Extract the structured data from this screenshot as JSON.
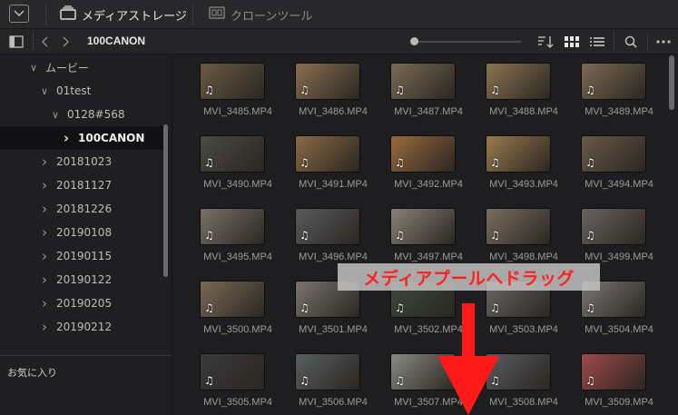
{
  "topbar": {
    "tab_media": "メディアストレージ",
    "tab_clone": "クローンツール"
  },
  "toolbar": {
    "path": "100CANON"
  },
  "sidebar": {
    "items": [
      {
        "label": "ムービー",
        "level": 2,
        "expanded": true
      },
      {
        "label": "01test",
        "level": 3,
        "expanded": true
      },
      {
        "label": "0128#568",
        "level": 4,
        "expanded": true
      },
      {
        "label": "100CANON",
        "level": 5,
        "expanded": false,
        "selected": true
      },
      {
        "label": "20181023",
        "level": 3
      },
      {
        "label": "20181127",
        "level": 3
      },
      {
        "label": "20181226",
        "level": 3
      },
      {
        "label": "20190108",
        "level": 3
      },
      {
        "label": "20190115",
        "level": 3
      },
      {
        "label": "20190122",
        "level": 3
      },
      {
        "label": "20190205",
        "level": 3
      },
      {
        "label": "20190212",
        "level": 3
      }
    ],
    "favorites_label": "お気に入り"
  },
  "clips": [
    {
      "name": "MVI_3485.MP4",
      "color": "#6b5a44"
    },
    {
      "name": "MVI_3486.MP4",
      "color": "#8a6f4f"
    },
    {
      "name": "MVI_3487.MP4",
      "color": "#7a6a55"
    },
    {
      "name": "MVI_3488.MP4",
      "color": "#8c7452"
    },
    {
      "name": "MVI_3489.MP4",
      "color": "#7d6a52"
    },
    {
      "name": "MVI_3490.MP4",
      "color": "#4a4a44"
    },
    {
      "name": "MVI_3491.MP4",
      "color": "#8a6a44"
    },
    {
      "name": "MVI_3492.MP4",
      "color": "#9a6a3c"
    },
    {
      "name": "MVI_3493.MP4",
      "color": "#9a7a4e"
    },
    {
      "name": "MVI_3494.MP4",
      "color": "#6a5a48"
    },
    {
      "name": "MVI_3495.MP4",
      "color": "#7a7268"
    },
    {
      "name": "MVI_3496.MP4",
      "color": "#5a5a5e"
    },
    {
      "name": "MVI_3497.MP4",
      "color": "#8a8278"
    },
    {
      "name": "MVI_3498.MP4",
      "color": "#7a6e60"
    },
    {
      "name": "MVI_3499.MP4",
      "color": "#6a6460"
    },
    {
      "name": "MVI_3500.MP4",
      "color": "#7a6a58"
    },
    {
      "name": "MVI_3501.MP4",
      "color": "#7a746c"
    },
    {
      "name": "MVI_3502.MP4",
      "color": "#3c4a3a"
    },
    {
      "name": "MVI_3503.MP4",
      "color": "#6a6664"
    },
    {
      "name": "MVI_3504.MP4",
      "color": "#7a7874"
    },
    {
      "name": "MVI_3505.MP4",
      "color": "#3a3a3c"
    },
    {
      "name": "MVI_3506.MP4",
      "color": "#5a5e60"
    },
    {
      "name": "MVI_3507.MP4",
      "color": "#8a8a84"
    },
    {
      "name": "MVI_3508.MP4",
      "color": "#5a5c60"
    },
    {
      "name": "MVI_3509.MP4",
      "color": "#a04a4a"
    }
  ],
  "overlay": {
    "callout_text": "メディアプールへドラッグ",
    "callout_color": "#ff2020"
  },
  "icons": [
    "panel-toggle-icon",
    "media-storage-icon",
    "clone-tool-icon",
    "sidebar-toggle-icon",
    "back-icon",
    "forward-icon",
    "sort-icon",
    "grid-view-icon",
    "list-view-icon",
    "search-icon",
    "more-icon",
    "music-note-icon"
  ]
}
